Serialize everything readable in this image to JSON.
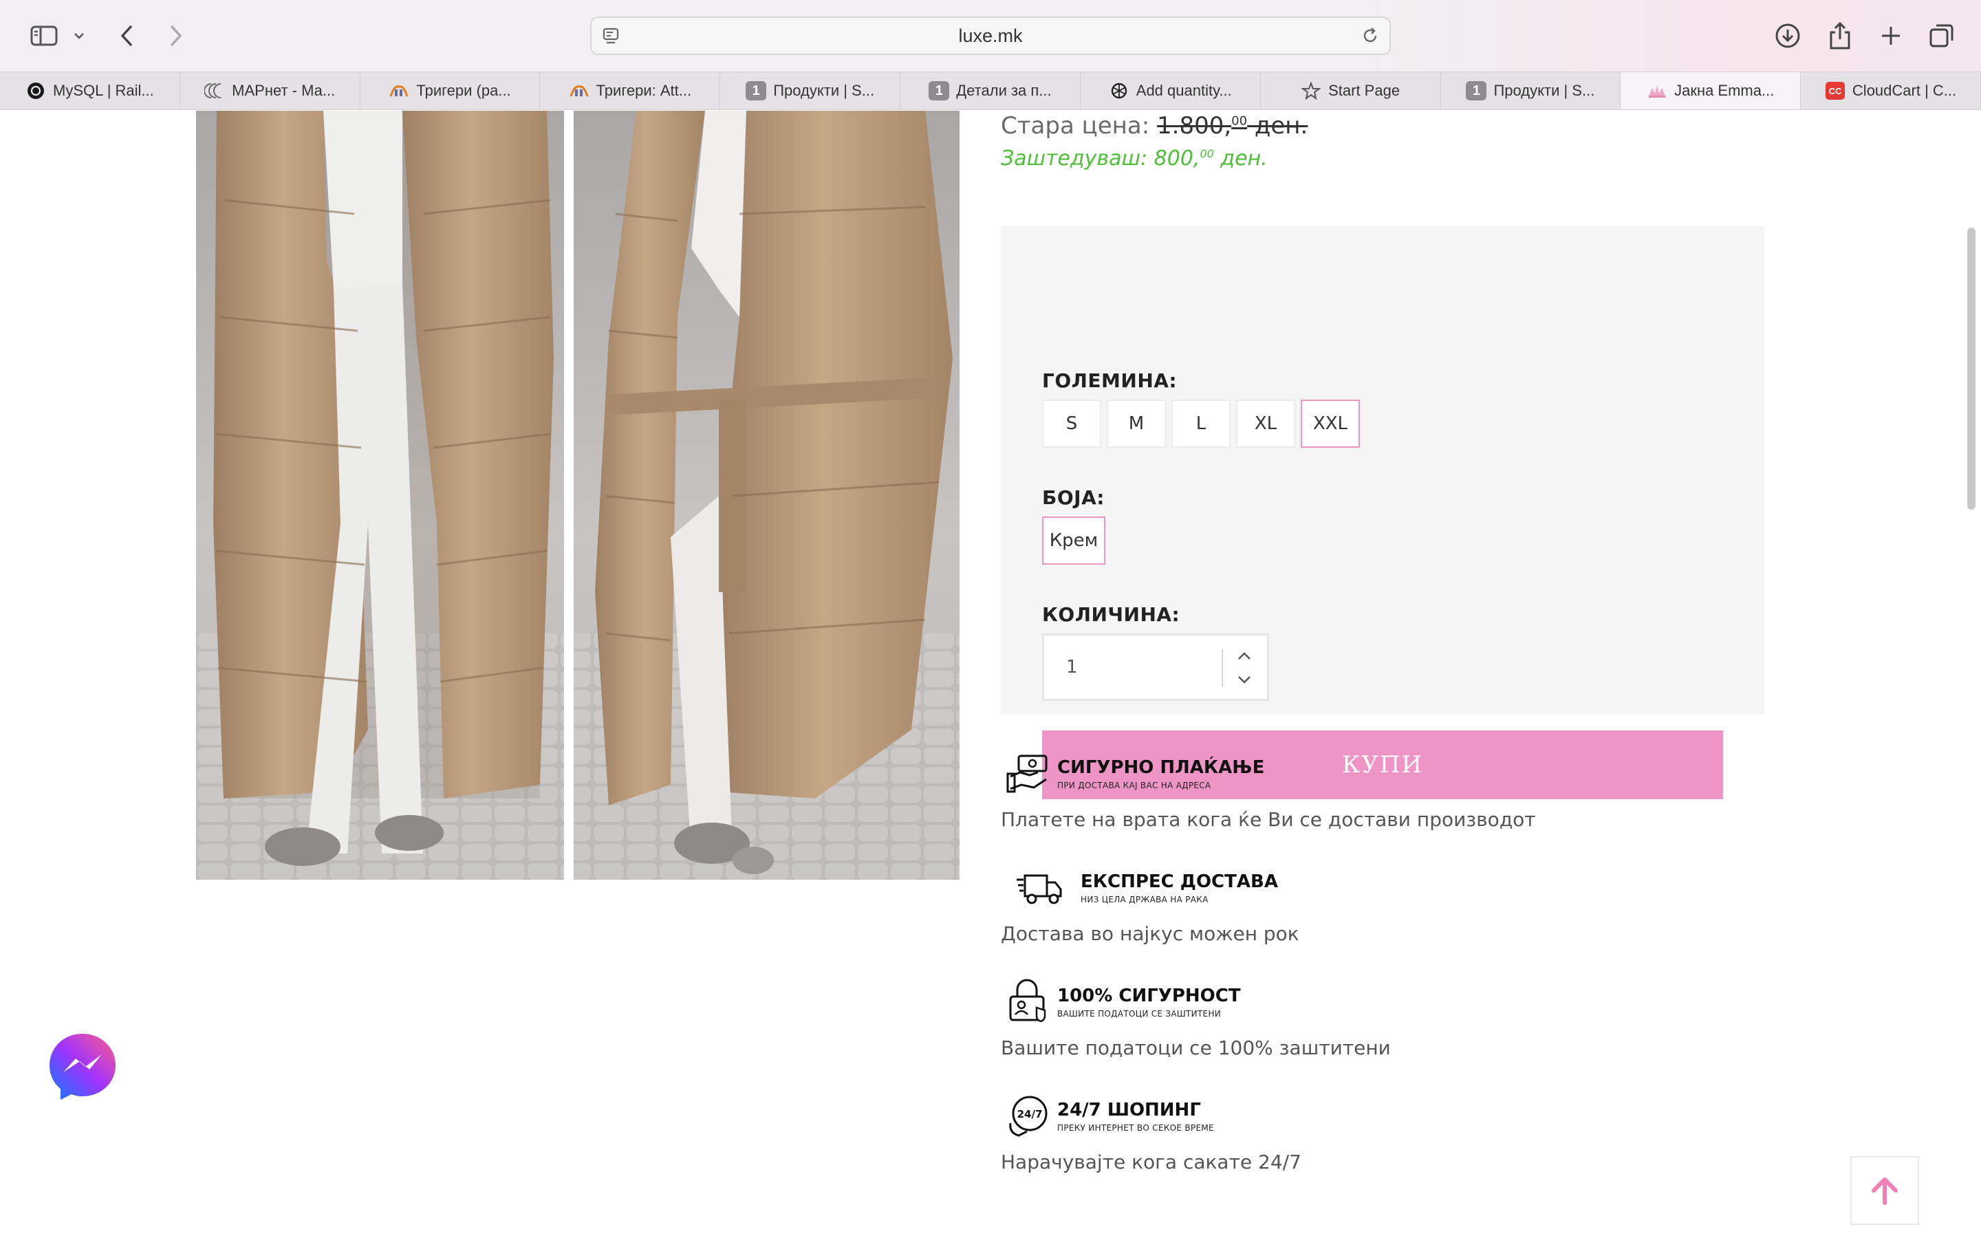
{
  "browser": {
    "url": "luxe.mk",
    "tabs": [
      {
        "label": "MySQL | Rail...",
        "icon": "mysql-icon"
      },
      {
        "label": "МАРнет - Ма...",
        "icon": "marnet-icon"
      },
      {
        "label": "Тригери (ра...",
        "icon": "phpmyadmin-icon"
      },
      {
        "label": "Тригери: Att...",
        "icon": "phpmyadmin-icon"
      },
      {
        "label": "Продукти | S...",
        "icon": "badge-1-icon",
        "badge": "1"
      },
      {
        "label": "Детали за п...",
        "icon": "badge-1-icon",
        "badge": "1"
      },
      {
        "label": "Add quantity...",
        "icon": "openai-icon"
      },
      {
        "label": "Start Page",
        "icon": "star-icon"
      },
      {
        "label": "Продукти | S...",
        "icon": "badge-1-icon",
        "badge": "1"
      },
      {
        "label": "Јакна Emma...",
        "icon": "luxe-icon",
        "active": true
      },
      {
        "label": "CloudCart | C...",
        "icon": "cloudcart-icon"
      }
    ]
  },
  "product": {
    "old_price_label": "Стара цена:",
    "old_price_value": "1.800,",
    "old_price_cents": "00",
    "old_price_currency": " ден.",
    "saving_label": "Заштедуваш:",
    "saving_value": "800,",
    "saving_cents": "00",
    "saving_currency": " ден.",
    "size_label": "ГОЛЕМИНА:",
    "sizes": [
      "S",
      "M",
      "L",
      "XL",
      "XXL"
    ],
    "selected_size": "XXL",
    "color_label": "БОЈА:",
    "colors": [
      "Крем"
    ],
    "quantity_label": "КОЛИЧИНА:",
    "quantity_value": "1",
    "buy_label": "КУПИ"
  },
  "features": [
    {
      "title": "СИГУРНО ПЛАЌАЊЕ",
      "subtitle": "ПРИ ДОСТАВА КАЈ ВАС НА АДРЕСА",
      "description": "Платете на врата кога ќе Ви се достави производот",
      "icon": "cash-payment-icon"
    },
    {
      "title": "ЕКСПРЕС ДОСТАВА",
      "subtitle": "НИЗ ЦЕЛА ДРЖАВА НА РАКА",
      "description": "Достава во најкус можен рок",
      "icon": "delivery-truck-icon"
    },
    {
      "title": "100% СИГУРНОСТ",
      "subtitle": "ВАШИТЕ ПОДАТОЦИ СЕ ЗАШТИТЕНИ",
      "description": "Вашите податоци се 100% заштитени",
      "icon": "lock-security-icon"
    },
    {
      "title": "24/7 ШОПИНГ",
      "subtitle": "ПРЕКУ ИНТЕРНЕТ ВО СЕКОЕ ВРЕМЕ",
      "description": "Нарачувајте кога сакате 24/7",
      "icon": "24-7-icon"
    }
  ],
  "colors": {
    "accent_pink": "#ef95c6",
    "saving_green": "#4fbf3a"
  }
}
